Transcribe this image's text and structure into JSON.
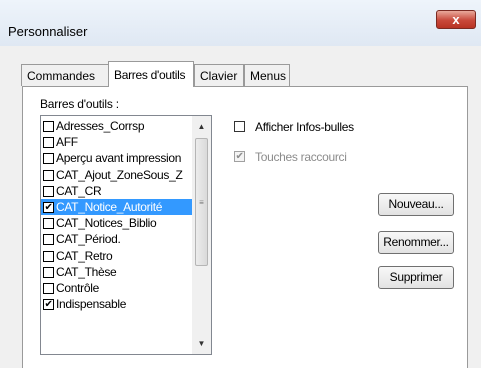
{
  "window": {
    "title": "Personnaliser",
    "close_glyph": "x"
  },
  "tabs": [
    {
      "label": "Commandes",
      "active": false
    },
    {
      "label": "Barres d'outils",
      "active": true
    },
    {
      "label": "Clavier",
      "active": false
    },
    {
      "label": "Menus",
      "active": false
    }
  ],
  "toolbars": {
    "label": "Barres d'outils :",
    "items": [
      {
        "label": "Adresses_Corrsp",
        "checked": false,
        "selected": false
      },
      {
        "label": "AFF",
        "checked": false,
        "selected": false
      },
      {
        "label": "Aperçu avant impression",
        "checked": false,
        "selected": false
      },
      {
        "label": "CAT_Ajout_ZoneSous_Z",
        "checked": false,
        "selected": false
      },
      {
        "label": "CAT_CR",
        "checked": false,
        "selected": false
      },
      {
        "label": "CAT_Notice_Autorité",
        "checked": true,
        "selected": true
      },
      {
        "label": "CAT_Notices_Biblio",
        "checked": false,
        "selected": false
      },
      {
        "label": "CAT_Périod.",
        "checked": false,
        "selected": false
      },
      {
        "label": "CAT_Retro",
        "checked": false,
        "selected": false
      },
      {
        "label": "CAT_Thèse",
        "checked": false,
        "selected": false
      },
      {
        "label": "Contrôle",
        "checked": false,
        "selected": false
      },
      {
        "label": "Indispensable",
        "checked": true,
        "selected": false
      }
    ],
    "scroll_up_glyph": "▲",
    "scroll_down_glyph": "▼",
    "grip_glyph": "≡"
  },
  "options": {
    "tooltips": {
      "label": "Afficher Infos-bulles",
      "checked": false,
      "enabled": true
    },
    "shortcuts": {
      "label": "Touches raccourci",
      "checked": true,
      "enabled": false
    }
  },
  "buttons": {
    "new": "Nouveau...",
    "rename": "Renommer...",
    "delete": "Supprimer"
  }
}
